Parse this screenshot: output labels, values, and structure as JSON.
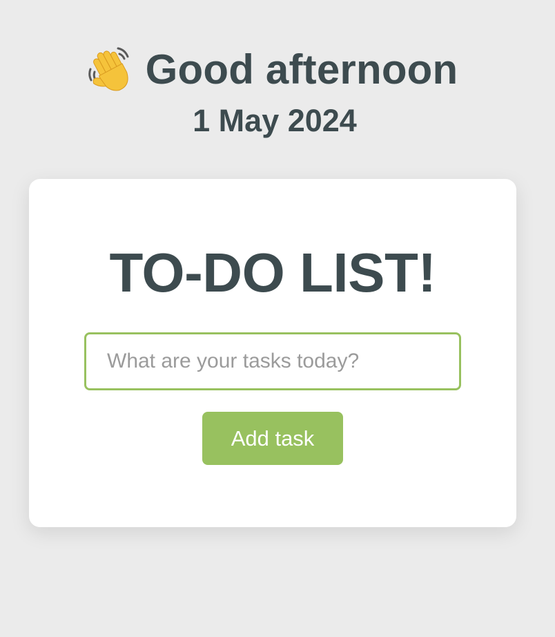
{
  "header": {
    "greeting": "Good afternoon",
    "date": "1 May 2024",
    "greeting_icon": "waving-hand-icon"
  },
  "todo": {
    "title": "TO-DO LIST!",
    "input_placeholder": "What are your tasks today?",
    "input_value": "",
    "add_button_label": "Add task"
  },
  "colors": {
    "background": "#ebebeb",
    "card": "#ffffff",
    "text": "#3d4b4f",
    "accent": "#98c15f",
    "placeholder": "#9b9b9b"
  }
}
